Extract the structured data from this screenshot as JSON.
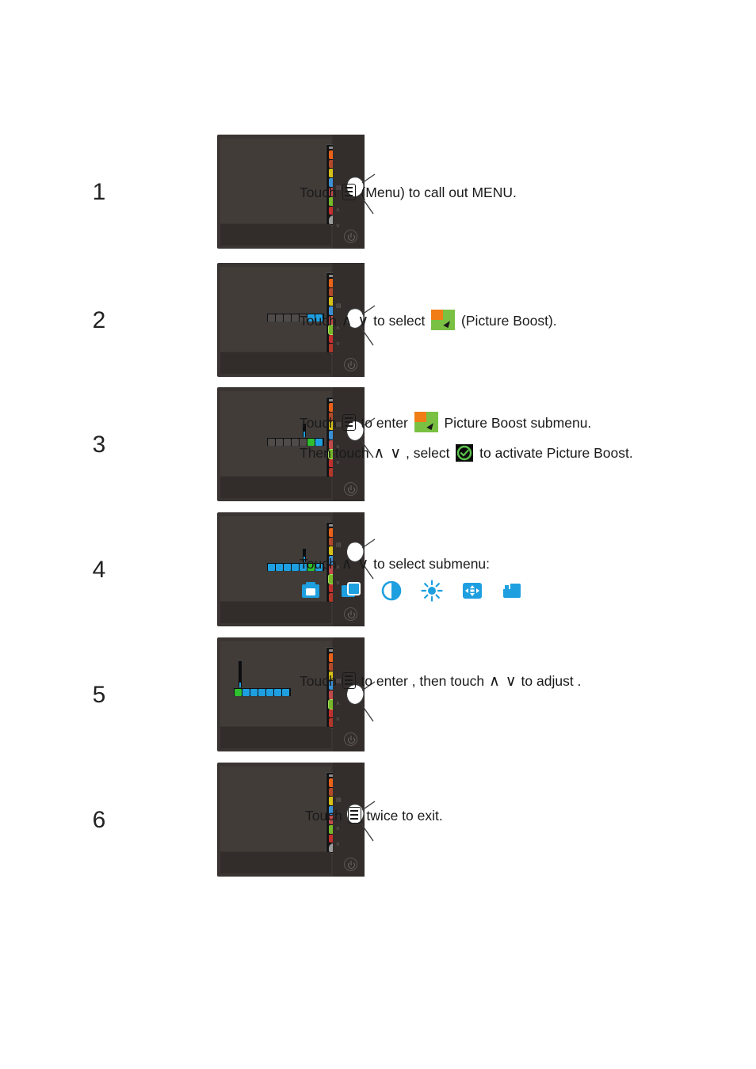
{
  "document": {
    "kind": "monitor-osd-instruction-sheet",
    "topic": "Picture Boost"
  },
  "accent_colors": {
    "submenu_icon_blue": "#1e9fe0",
    "picture_boost_green": "#7ac143",
    "picture_boost_orange": "#f07d16",
    "osd_highlight_green": "#2fbf2f",
    "text": "#1a1a1a",
    "monitor_body": "#3a3533",
    "monitor_screen": "#423c39"
  },
  "steps": [
    {
      "number": "1",
      "lines": [
        {
          "parts": [
            {
              "type": "text",
              "value": "Touch "
            },
            {
              "type": "icon",
              "name": "menu-icon"
            },
            {
              "type": "text",
              "value": " (Menu) to  call out MENU."
            }
          ]
        }
      ]
    },
    {
      "number": "2",
      "lines": [
        {
          "parts": [
            {
              "type": "text",
              "value": "Touch "
            },
            {
              "type": "icon",
              "name": "chevron-up-icon",
              "glyph": "∧"
            },
            {
              "type": "icon",
              "name": "chevron-down-icon",
              "glyph": "∨"
            },
            {
              "type": "text",
              "value": " to select "
            },
            {
              "type": "icon",
              "name": "picture-boost-icon"
            },
            {
              "type": "text",
              "value": " (Picture Boost)."
            }
          ]
        }
      ]
    },
    {
      "number": "3",
      "lines": [
        {
          "parts": [
            {
              "type": "text",
              "value": "Touch "
            },
            {
              "type": "icon",
              "name": "menu-icon"
            },
            {
              "type": "text",
              "value": " to enter "
            },
            {
              "type": "icon",
              "name": "picture-boost-icon"
            },
            {
              "type": "text",
              "value": " Picture Boost  submenu."
            }
          ]
        },
        {
          "parts": [
            {
              "type": "text",
              "value": "Then touch "
            },
            {
              "type": "icon",
              "name": "chevron-up-icon",
              "glyph": "∧"
            },
            {
              "type": "icon",
              "name": "chevron-down-icon",
              "glyph": "∨"
            },
            {
              "type": "text",
              "value": " , select "
            },
            {
              "type": "icon",
              "name": "check-circle-icon"
            },
            {
              "type": "text",
              "value": " to activate Picture Boost."
            }
          ]
        }
      ]
    },
    {
      "number": "4",
      "lines": [
        {
          "parts": [
            {
              "type": "text",
              "value": "Touch "
            },
            {
              "type": "icon",
              "name": "chevron-up-icon",
              "glyph": "∧"
            },
            {
              "type": "icon",
              "name": "chevron-down-icon",
              "glyph": "∨"
            },
            {
              "type": "text",
              "value": " to select submenu:"
            }
          ]
        }
      ],
      "submenu_icons": [
        {
          "name": "bright-frame-icon"
        },
        {
          "name": "frame-size-icon"
        },
        {
          "name": "contrast-icon"
        },
        {
          "name": "brightness-icon"
        },
        {
          "name": "frame-position-icon"
        },
        {
          "name": "frame-shape-icon"
        }
      ]
    },
    {
      "number": "5",
      "lines": [
        {
          "parts": [
            {
              "type": "text",
              "value": "Touch "
            },
            {
              "type": "icon",
              "name": "menu-icon"
            },
            {
              "type": "text",
              "value": " to enter , then touch "
            },
            {
              "type": "icon",
              "name": "chevron-up-icon",
              "glyph": "∧"
            },
            {
              "type": "icon",
              "name": "chevron-down-icon",
              "glyph": "∨"
            },
            {
              "type": "text",
              "value": " to  adjust ."
            }
          ]
        }
      ]
    },
    {
      "number": "6",
      "lines": [
        {
          "parts": [
            {
              "type": "text",
              "value": "Touch "
            },
            {
              "type": "icon",
              "name": "menu-icon"
            },
            {
              "type": "text",
              "value": " twice to exit."
            }
          ]
        }
      ]
    }
  ],
  "monitor_osd": {
    "main_menu_icons": [
      {
        "name": "luminance-icon",
        "color": "#e8621a"
      },
      {
        "name": "image-setup-icon",
        "color": "#b04a2a"
      },
      {
        "name": "color-setup-icon",
        "color": "#d6c018"
      },
      {
        "name": "picture-boost-icon",
        "color": "#3b8fd4"
      },
      {
        "name": "osd-setup-icon",
        "color": "#c04a4a"
      },
      {
        "name": "extra-icon",
        "color": "#76b82a"
      },
      {
        "name": "reset-icon",
        "color": "#c22f2f"
      },
      {
        "name": "exit-icon",
        "color": "#9a9a9a"
      }
    ],
    "submenu_bar_states": {
      "step2": [
        "grey",
        "grey",
        "grey",
        "grey",
        "grey",
        "blue",
        "blue"
      ],
      "step3": [
        "grey",
        "grey",
        "grey",
        "grey",
        "grey",
        "green",
        "blue"
      ],
      "step4": [
        "blue",
        "blue",
        "blue",
        "blue",
        "blue",
        "green",
        "blue"
      ],
      "step5": [
        "green",
        "blue",
        "blue",
        "blue",
        "blue",
        "blue",
        "blue"
      ]
    }
  },
  "monitor_controls": {
    "menu_mark": "▤",
    "up_mark": "˄",
    "down_mark": "˅",
    "power_button": "power-button"
  }
}
